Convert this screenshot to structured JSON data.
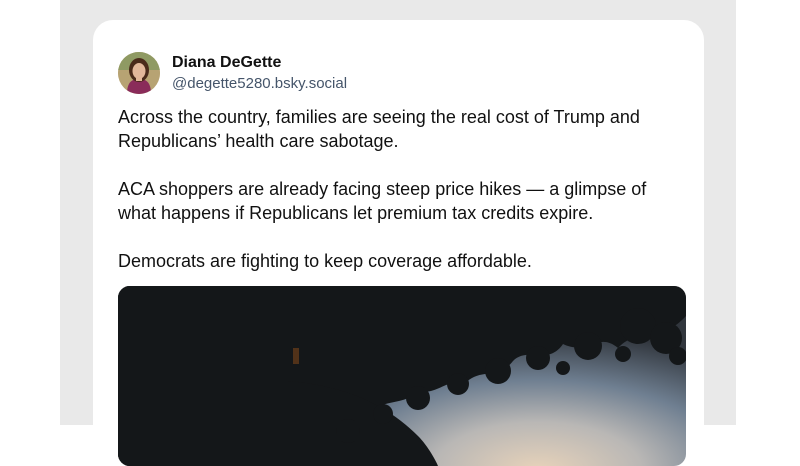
{
  "post": {
    "author": {
      "display_name": "Diana DeGette",
      "handle": "@degette5280.bsky.social"
    },
    "paragraphs": [
      "Across the country, families are seeing the real cost of Trump and Republicans’ health care sabotage.",
      "ACA shoppers are already facing steep price hikes — a glimpse of what happens if Republicans let premium tax credits expire.",
      "Democrats are fighting to keep coverage affordable."
    ]
  },
  "colors": {
    "backdrop": "#e9e9e9",
    "card": "#ffffff",
    "text": "#111111",
    "handle": "#45556a"
  }
}
